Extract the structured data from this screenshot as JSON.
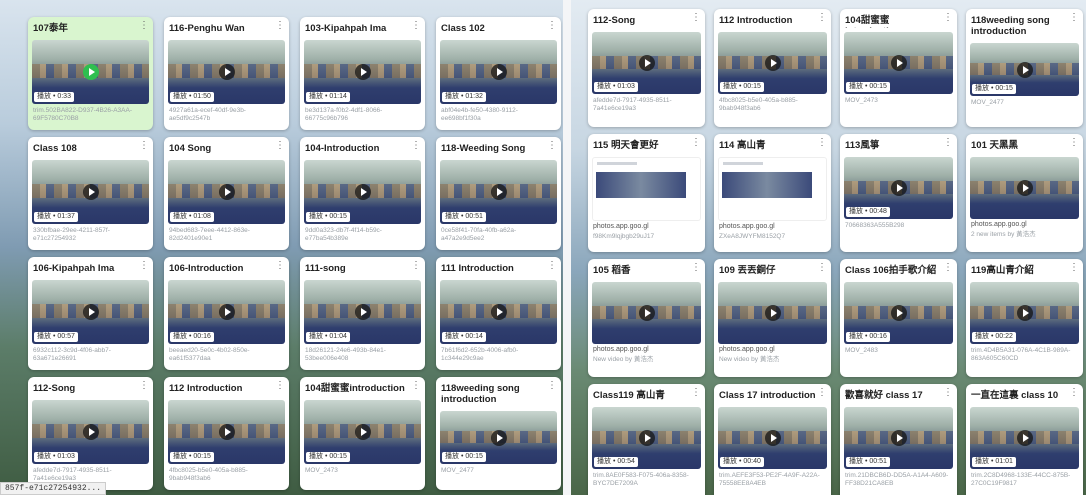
{
  "left": {
    "cards": [
      {
        "title": "107泰年",
        "duration": "0:33",
        "id": "trim.502BA822-D937-4B26-A3AA-69F5780C70B8",
        "highlight": true
      },
      {
        "title": "116-Penghu Wan",
        "duration": "01:50",
        "id": "4927a61a-ecef-40df-9e3b-ae5df9c2547b"
      },
      {
        "title": "103-Kipahpah Ima",
        "duration": "01:14",
        "id": "be3d137a-f0b2-4df1-8066-66775c96b796"
      },
      {
        "title": "Class 102",
        "duration": "01:32",
        "id": "abf04e4b-fe50-4380-9112-ee698bf1f30a"
      },
      {
        "title": "Class 108",
        "duration": "01:37",
        "id": "330bfbae-29ee-4211-857f-e71c27254932"
      },
      {
        "title": "104 Song",
        "duration": "01:08",
        "id": "94bed683-7eee-4412-863e-82d2401e90e1"
      },
      {
        "title": "104-Introduction",
        "duration": "00:15",
        "id": "9dd0a323-db7f-4f14-b59c-e77ba54b389e"
      },
      {
        "title": "118-Weeding Song",
        "duration": "00:51",
        "id": "0ce58f41-70fa-40fb-a62a-a47a2e9d5ee2"
      },
      {
        "title": "106-Kipahpah Ima",
        "duration": "00:57",
        "id": "6932c112-3c9d-4f06-abb7-63a671e26691"
      },
      {
        "title": "106-Introduction",
        "duration": "00:16",
        "id": "beeaed20-5e0c-4b02-850e-ea61f5377daa"
      },
      {
        "title": "111-song",
        "duration": "01:04",
        "id": "18d26121-24e6-493b-84e1-53bee006e408"
      },
      {
        "title": "111 Introduction",
        "duration": "00:14",
        "id": "7b61f6d2-652b-4006-afb0-1c344e29c9ae"
      },
      {
        "title": "112-Song",
        "duration": "01:03",
        "id": "afedde7d-7917-4935-8511-7a41e6ce19a3"
      },
      {
        "title": "112 Introduction",
        "duration": "00:15",
        "id": "4fbc8025-b5e0-405a-b885-9bab948f3ab6"
      },
      {
        "title": "104甜蜜蜜introduction",
        "duration": "00:15",
        "id": "MOV_2473"
      },
      {
        "title": "118weeding song introduction",
        "duration": "00:15",
        "id": "MOV_2477",
        "twoline": true
      }
    ],
    "statusbar": "857f-e71c27254932..."
  },
  "right": {
    "cards": [
      {
        "title": "112-Song",
        "duration": "01:03",
        "id": "afedde7d-7917-4935-8511-7a41e6ce19a3"
      },
      {
        "title": "112 Introduction",
        "duration": "00:15",
        "id": "4fbc8025-b5e0-405a-b885-9bab948f3ab6"
      },
      {
        "title": "104甜蜜蜜introduction",
        "duration": "00:15",
        "id": "MOV_2473"
      },
      {
        "title": "118weeding song introduction",
        "duration": "00:15",
        "id": "MOV_2477",
        "twoline": true
      },
      {
        "title": "115 明天會更好",
        "doc": true,
        "domain": "photos.app.goo.gl",
        "id": "f98Km9lqjbgb29uJ17"
      },
      {
        "title": "114 高山青",
        "doc": true,
        "domain": "photos.app.goo.gl",
        "id": "ZXeA8JWYFM8152Q7"
      },
      {
        "title": "113風箏",
        "duration": "00:48",
        "id": "70668363A555B298"
      },
      {
        "title": "101 天黑黑",
        "domain": "photos.app.goo.gl",
        "id": "2 new items by 黃浩杰",
        "noduration": true
      },
      {
        "title": "105 稻香",
        "domain": "photos.app.goo.gl",
        "id": "New video by 黃浩杰",
        "noduration": true
      },
      {
        "title": "109 丟丟銅仔",
        "domain": "photos.app.goo.gl",
        "id": "New video by 黃浩杰",
        "noduration": true
      },
      {
        "title": "Class 106拍手歌介紹",
        "duration": "00:16",
        "id": "MOV_2483"
      },
      {
        "title": "119高山青介紹",
        "duration": "00:22",
        "id": "trim.4D4B5A31-076A-4C1B-989A-863A605C60CD"
      },
      {
        "title": "Class119 高山青",
        "duration": "00:54",
        "id": "trim.8AE0F583-F075-406a-8358-BYC7DE7209A"
      },
      {
        "title": "Class 17 introduction",
        "duration": "00:40",
        "id": "trim.AEFE3F53-PE2F-4A9F-A22A-75558EE8A4EB"
      },
      {
        "title": "歡喜就好 class 17",
        "duration": "00:51",
        "id": "trim.21DBCB6D-DD5A-A1A4-A609-FF38D21CA8EB"
      },
      {
        "title": "一直在這裏 class 10",
        "duration": "01:01",
        "id": "trim.2C8D4968-133E-44CC-875B-27C0C19F9817"
      }
    ]
  },
  "badge_label": "播放"
}
